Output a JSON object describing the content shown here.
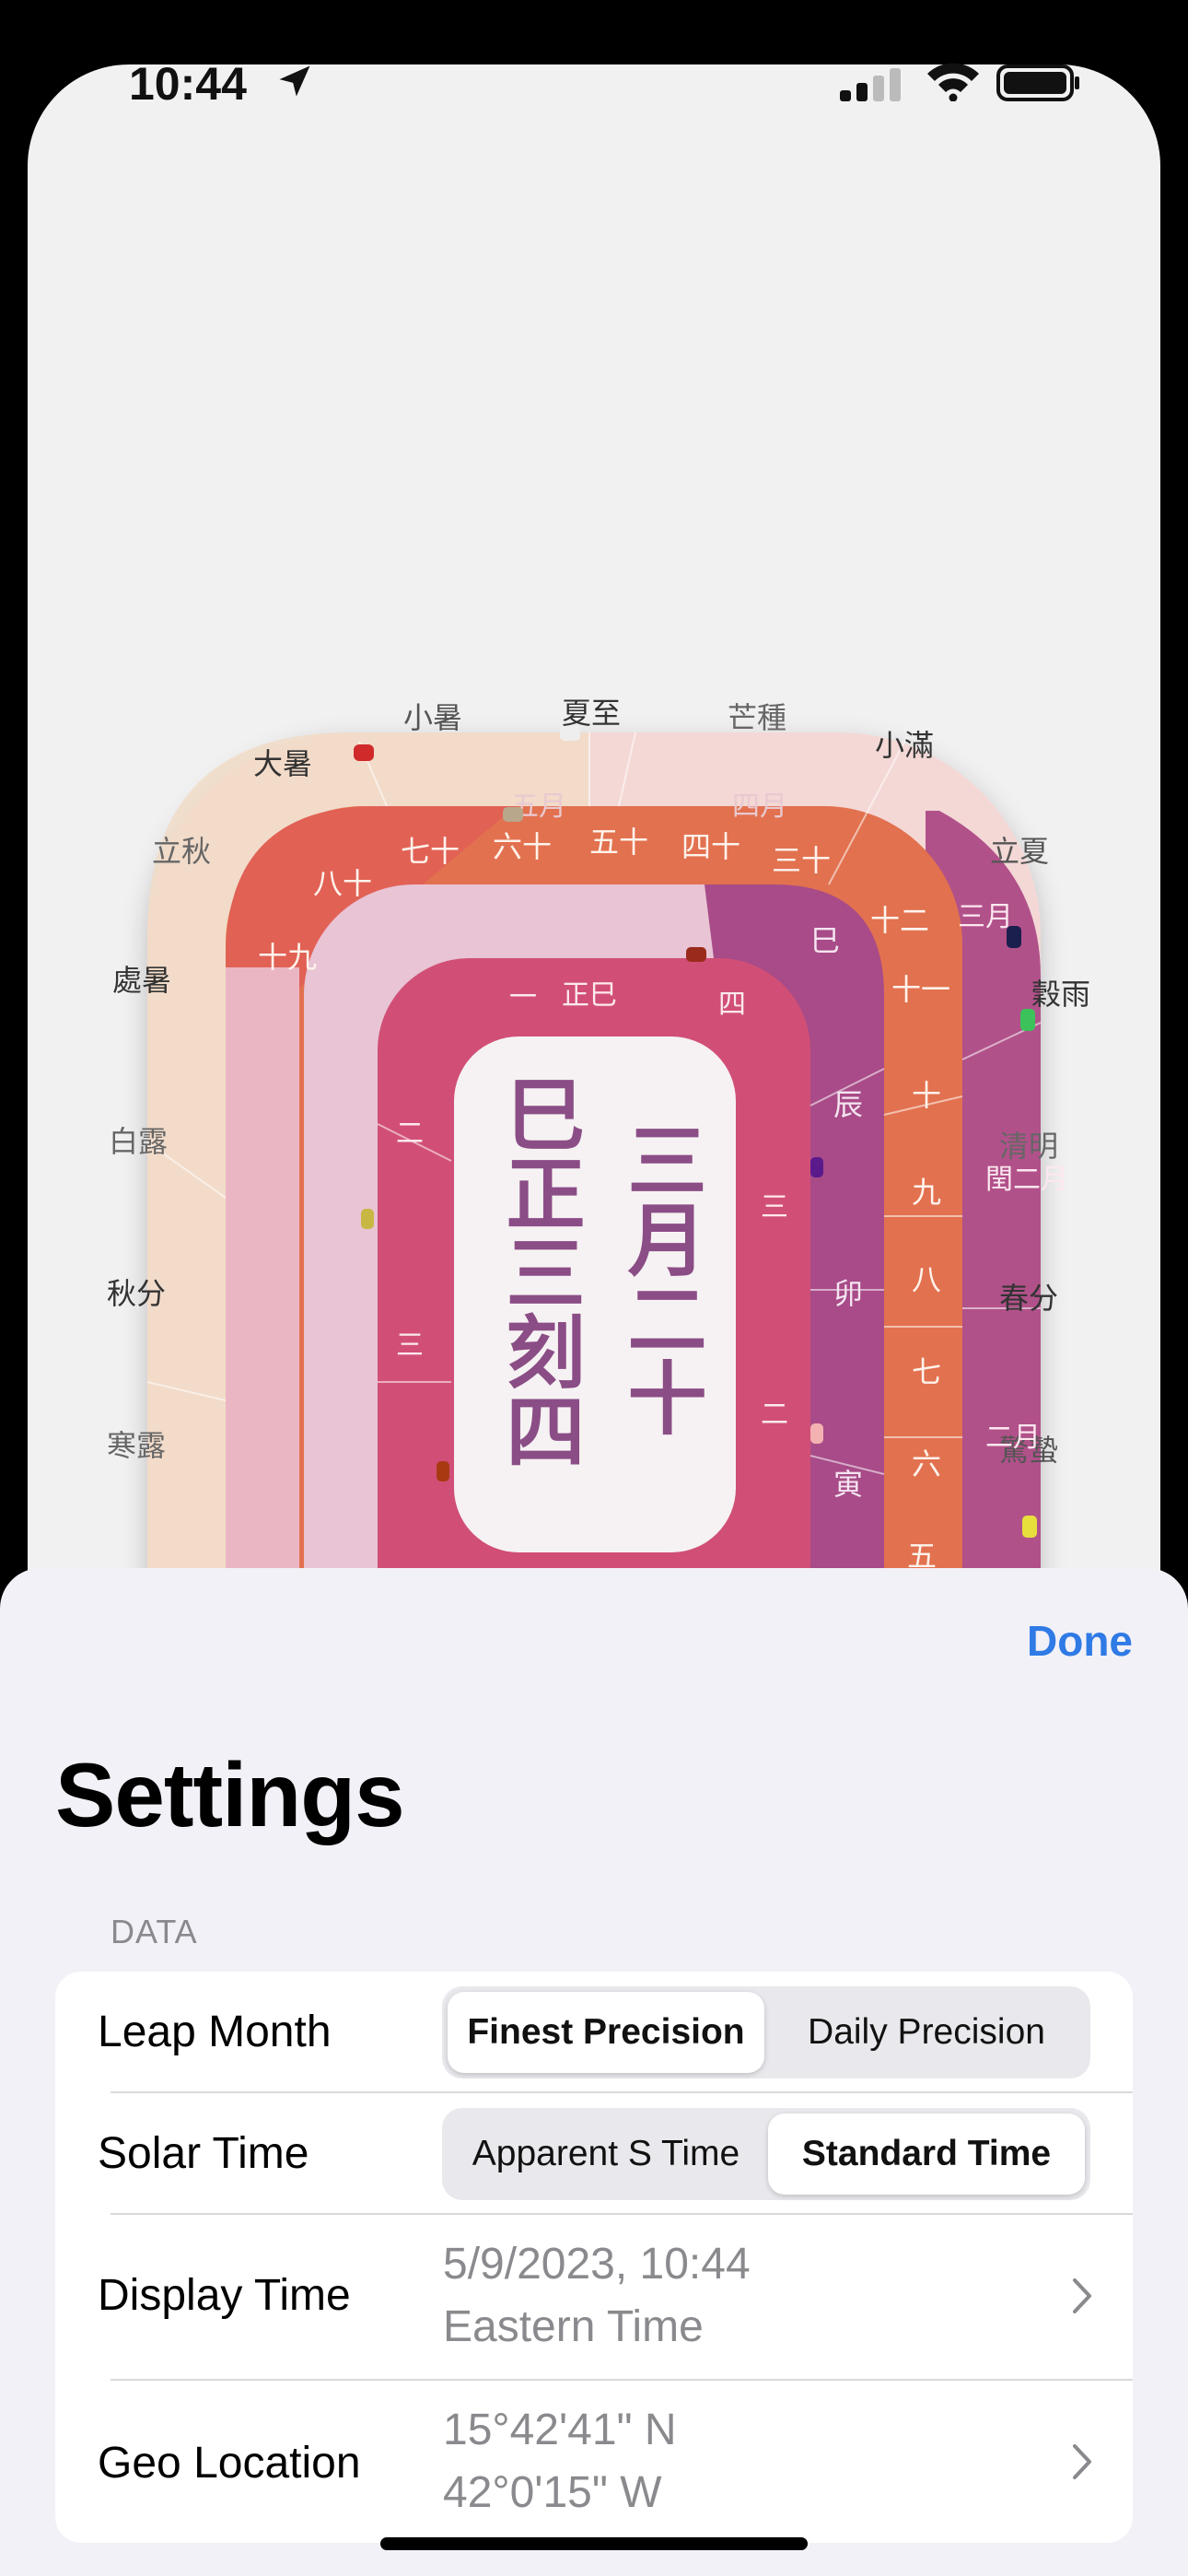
{
  "status_bar": {
    "time": "10:44"
  },
  "clock": {
    "center_date": "三月二十",
    "center_time": "巳正三刻四",
    "outer_terms": [
      "夏至",
      "芒種",
      "小滿",
      "立夏",
      "穀雨",
      "清明",
      "春分",
      "驚蟄",
      "小暑",
      "大暑",
      "立秋",
      "處暑",
      "白露",
      "秋分",
      "寒露"
    ],
    "month_ring": [
      "三月",
      "閏二月",
      "二月",
      "五月",
      "四月"
    ],
    "day_ring": [
      "五十",
      "四十",
      "三十",
      "六十",
      "七十",
      "八十",
      "十九",
      "十二",
      "十一",
      "十",
      "九",
      "八",
      "七",
      "六",
      "五"
    ],
    "hour_ring": [
      "巳",
      "辰",
      "卯",
      "寅"
    ],
    "quarter_ring": [
      "正巳",
      "一",
      "四",
      "二",
      "三",
      "三",
      "二"
    ]
  },
  "sheet": {
    "done_label": "Done",
    "title": "Settings",
    "section_header": "DATA",
    "rows": [
      {
        "label": "Leap Month",
        "options": [
          "Finest Precision",
          "Daily Precision"
        ],
        "selected": 0
      },
      {
        "label": "Solar Time",
        "options": [
          "Apparent S Time",
          "Standard Time"
        ],
        "selected": 1
      },
      {
        "label": "Display Time",
        "value_line1": "5/9/2023, 10:44",
        "value_line2": "Eastern Time"
      },
      {
        "label": "Geo Location",
        "value_line1": "15°42'41\" N",
        "value_line2": "42°0'15\" W"
      }
    ]
  },
  "colors": {
    "accent": "#2f7ae5",
    "center_text": "#8b4d86",
    "outer_ring": "#f0ccd2",
    "day_ring": "#e2714f",
    "hour_ring": "#ce4a74",
    "month_ring": "#a64d85"
  }
}
